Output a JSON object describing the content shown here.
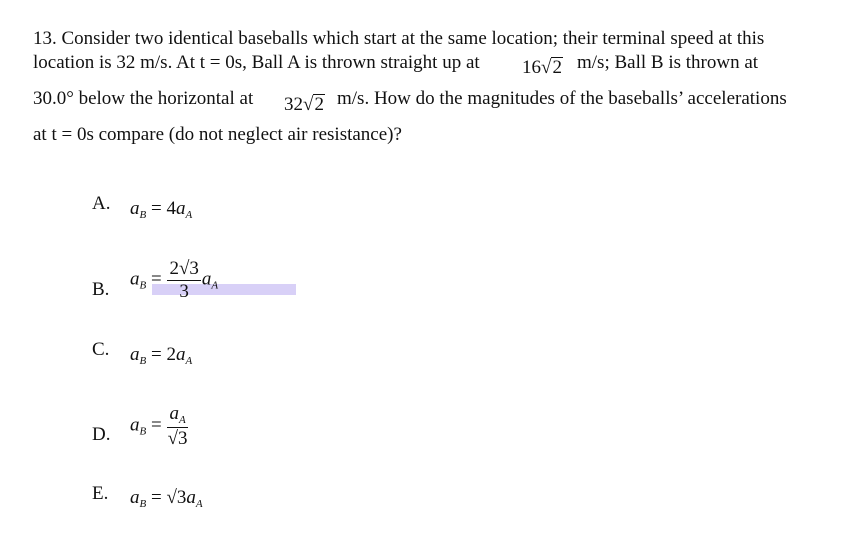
{
  "question": {
    "number": "13.",
    "line1": "13. Consider two identical baseballs which start at the same location; their terminal speed at this",
    "line2_a": "location is 32 m/s. At t = 0s, Ball A is thrown straight up at",
    "speed_a_coef": "16",
    "speed_a_rad": "2",
    "line2_b": "m/s; Ball B is thrown at",
    "line3_a": "30.0° below the horizontal at",
    "speed_b_coef": "32",
    "speed_b_rad": "2",
    "line3_b": "m/s. How do the magnitudes of the baseballs’ accelerations",
    "line4": "at t = 0s compare (do not neglect air resistance)?"
  },
  "options": [
    {
      "label": "A.",
      "lhs": "a",
      "lhs_sub": "B",
      "eq": " = ",
      "coef": "4",
      "rhs": "a",
      "rhs_sub": "A"
    },
    {
      "label": "B.",
      "lhs": "a",
      "lhs_sub": "B",
      "eq": " = ",
      "num": "2√3",
      "den": "3",
      "rhs": "a",
      "rhs_sub": "A",
      "highlighted": true
    },
    {
      "label": "C.",
      "lhs": "a",
      "lhs_sub": "B",
      "eq": " = ",
      "coef": "2",
      "rhs": "a",
      "rhs_sub": "A"
    },
    {
      "label": "D.",
      "lhs": "a",
      "lhs_sub": "B",
      "eq": " = ",
      "num": "a",
      "num_sub": "A",
      "den": "√3"
    },
    {
      "label": "E.",
      "lhs": "a",
      "lhs_sub": "B",
      "eq": " = ",
      "coef": "√3",
      "rhs": "a",
      "rhs_sub": "A"
    }
  ],
  "highlight_color": "#d8d0f7"
}
